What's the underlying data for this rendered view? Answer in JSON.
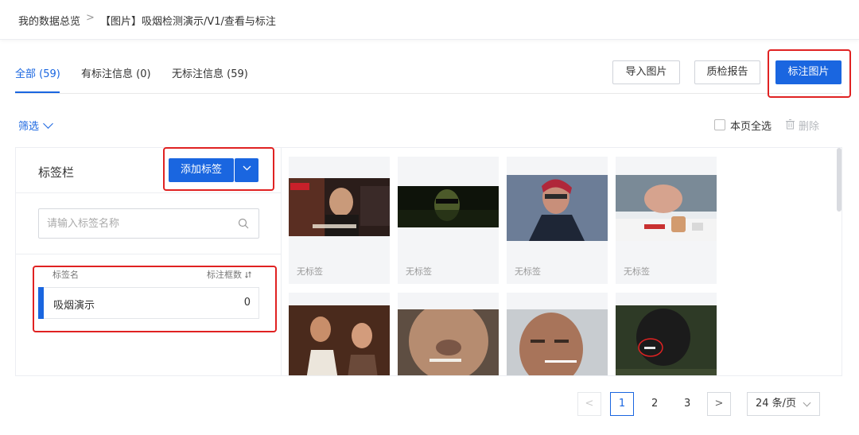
{
  "breadcrumb": {
    "root": "我的数据总览",
    "separator": ">",
    "current": "【图片】吸烟检测演示/V1/查看与标注"
  },
  "tabs": [
    {
      "label": "全部 (59)",
      "active": true
    },
    {
      "label": "有标注信息 (0)",
      "active": false
    },
    {
      "label": "无标注信息 (59)",
      "active": false
    }
  ],
  "toolbar": {
    "import_label": "导入图片",
    "report_label": "质检报告",
    "annotate_label": "标注图片"
  },
  "filter": {
    "label": "筛选",
    "select_all_label": "本页全选",
    "delete_label": "删除"
  },
  "label_panel": {
    "title": "标签栏",
    "add_label": "添加标签",
    "search_placeholder": "请输入标签名称",
    "col_name": "标签名",
    "col_count": "标注框数",
    "items": [
      {
        "name": "吸烟演示",
        "count": "0",
        "color": "#1a66e0"
      }
    ]
  },
  "images": [
    {
      "caption": "无标签"
    },
    {
      "caption": "无标签"
    },
    {
      "caption": "无标签"
    },
    {
      "caption": "无标签"
    },
    {
      "caption": ""
    },
    {
      "caption": ""
    },
    {
      "caption": ""
    },
    {
      "caption": ""
    }
  ],
  "pagination": {
    "prev": "<",
    "pages": [
      "1",
      "2",
      "3"
    ],
    "current": "1",
    "next": ">",
    "page_size": "24 条/页"
  },
  "colors": {
    "accent": "#1a66e0",
    "highlight": "#e02222"
  }
}
